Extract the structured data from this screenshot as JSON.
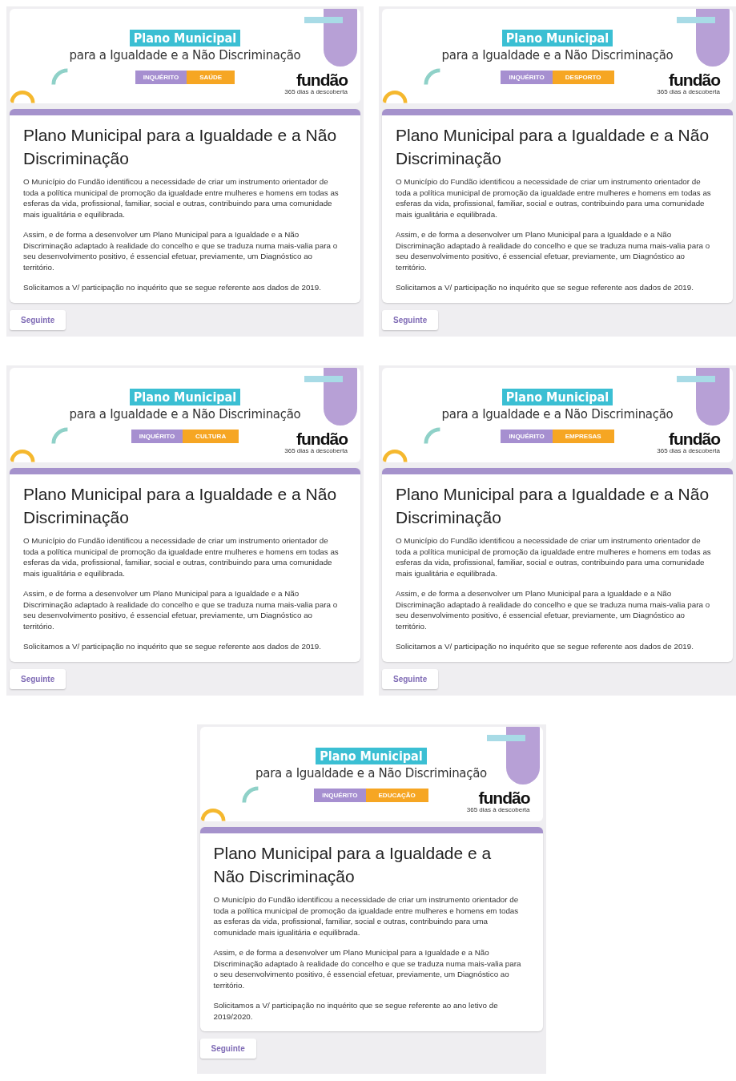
{
  "panels": [
    {
      "banner": {
        "title": "Plano Municipal",
        "subtitle": "para a Igualdade e a Não Discriminação",
        "tag_left": "INQUÉRITO",
        "tag_right": "SAÚDE",
        "logo": "fundão",
        "logo_tagline": "365 dias à descoberta"
      },
      "form": {
        "title": "Plano Municipal para a Igualdade e a Não Discriminação",
        "paragraphs": [
          "O Município do Fundão identificou a necessidade de criar um instrumento orientador de toda a política municipal de promoção da igualdade entre mulheres e homens em todas as esferas da vida, profissional, familiar, social e outras, contribuindo para uma comunidade mais igualitária e equilibrada.",
          "Assim, e de forma a desenvolver um Plano Municipal para a Igualdade e a Não Discriminação adaptado à realidade do concelho e que se traduza numa mais-valia para o seu desenvolvimento positivo, é essencial efetuar, previamente, um Diagnóstico ao território.",
          "Solicitamos a V/ participação no inquérito que se segue referente aos dados de 2019."
        ],
        "button": "Seguinte"
      }
    },
    {
      "banner": {
        "title": "Plano Municipal",
        "subtitle": "para a Igualdade e a Não Discriminação",
        "tag_left": "INQUÉRITO",
        "tag_right": "DESPORTO",
        "logo": "fundão",
        "logo_tagline": "365 dias à descoberta"
      },
      "form": {
        "title": "Plano Municipal para a Igualdade e a Não Discriminação",
        "paragraphs": [
          "O Município do Fundão identificou a necessidade de criar um instrumento orientador de toda a política municipal de promoção da igualdade entre mulheres e homens em todas as esferas da vida, profissional, familiar, social e outras, contribuindo para uma comunidade mais igualitária e equilibrada.",
          "Assim, e de forma a desenvolver um Plano Municipal para a Igualdade e a Não Discriminação adaptado à realidade do concelho e que se traduza numa mais-valia para o seu desenvolvimento positivo, é essencial efetuar, previamente, um Diagnóstico ao território.",
          "Solicitamos a V/ participação no inquérito que se segue referente aos dados de 2019."
        ],
        "button": "Seguinte"
      }
    },
    {
      "banner": {
        "title": "Plano Municipal",
        "subtitle": "para a Igualdade e a Não Discriminação",
        "tag_left": "INQUÉRITO",
        "tag_right": "CULTURA",
        "logo": "fundão",
        "logo_tagline": "365 dias à descoberta"
      },
      "form": {
        "title": "Plano Municipal para a Igualdade e a Não Discriminação",
        "paragraphs": [
          "O Município do Fundão identificou a necessidade de criar um instrumento orientador de toda a política municipal de promoção da igualdade entre mulheres e homens em todas as esferas da vida, profissional, familiar, social e outras, contribuindo para uma comunidade mais igualitária e equilibrada.",
          "Assim, e de forma a desenvolver um Plano Municipal para a Igualdade e a Não Discriminação adaptado à realidade do concelho e que se traduza numa mais-valia para o seu desenvolvimento positivo, é essencial efetuar, previamente, um Diagnóstico ao território.",
          "Solicitamos a V/ participação no inquérito que se segue referente aos dados de 2019."
        ],
        "button": "Seguinte"
      }
    },
    {
      "banner": {
        "title": "Plano Municipal",
        "subtitle": "para a Igualdade e a Não Discriminação",
        "tag_left": "INQUÉRITO",
        "tag_right": "EMPRESAS",
        "logo": "fundão",
        "logo_tagline": "365 dias à descoberta"
      },
      "form": {
        "title": "Plano Municipal para a Igualdade e a Não Discriminação",
        "paragraphs": [
          "O Município do Fundão identificou a necessidade de criar um instrumento orientador de toda a política municipal de promoção da igualdade entre mulheres e homens em todas as esferas da vida, profissional, familiar, social e outras, contribuindo para uma comunidade mais igualitária e equilibrada.",
          "Assim, e de forma a desenvolver um Plano Municipal para a Igualdade e a Não Discriminação adaptado à realidade do concelho e que se traduza numa mais-valia para o seu desenvolvimento positivo, é essencial efetuar, previamente, um Diagnóstico ao território.",
          "Solicitamos a V/ participação no inquérito que se segue referente aos dados de 2019."
        ],
        "button": "Seguinte"
      }
    },
    {
      "banner": {
        "title": "Plano Municipal",
        "subtitle": "para a Igualdade e a Não Discriminação",
        "tag_left": "INQUÉRITO",
        "tag_right": "EDUCAÇÃO",
        "logo": "fundão",
        "logo_tagline": "365 dias à descoberta"
      },
      "form": {
        "title": "Plano Municipal para a Igualdade e a Não Discriminação",
        "paragraphs": [
          "O Município do Fundão identificou a necessidade de criar um instrumento orientador de toda a política municipal de promoção da igualdade entre mulheres e homens em todas as esferas da vida, profissional, familiar, social e outras, contribuindo para uma comunidade mais igualitária e equilibrada.",
          "Assim, e de forma a desenvolver um Plano Municipal para a Igualdade e a Não Discriminação adaptado à realidade do concelho e que se traduza numa mais-valia para o seu desenvolvimento positivo, é essencial efetuar, previamente, um Diagnóstico ao território.",
          "Solicitamos a V/ participação no inquérito que se segue referente ao ano letivo de 2019/2020."
        ],
        "button": "Seguinte"
      }
    }
  ]
}
